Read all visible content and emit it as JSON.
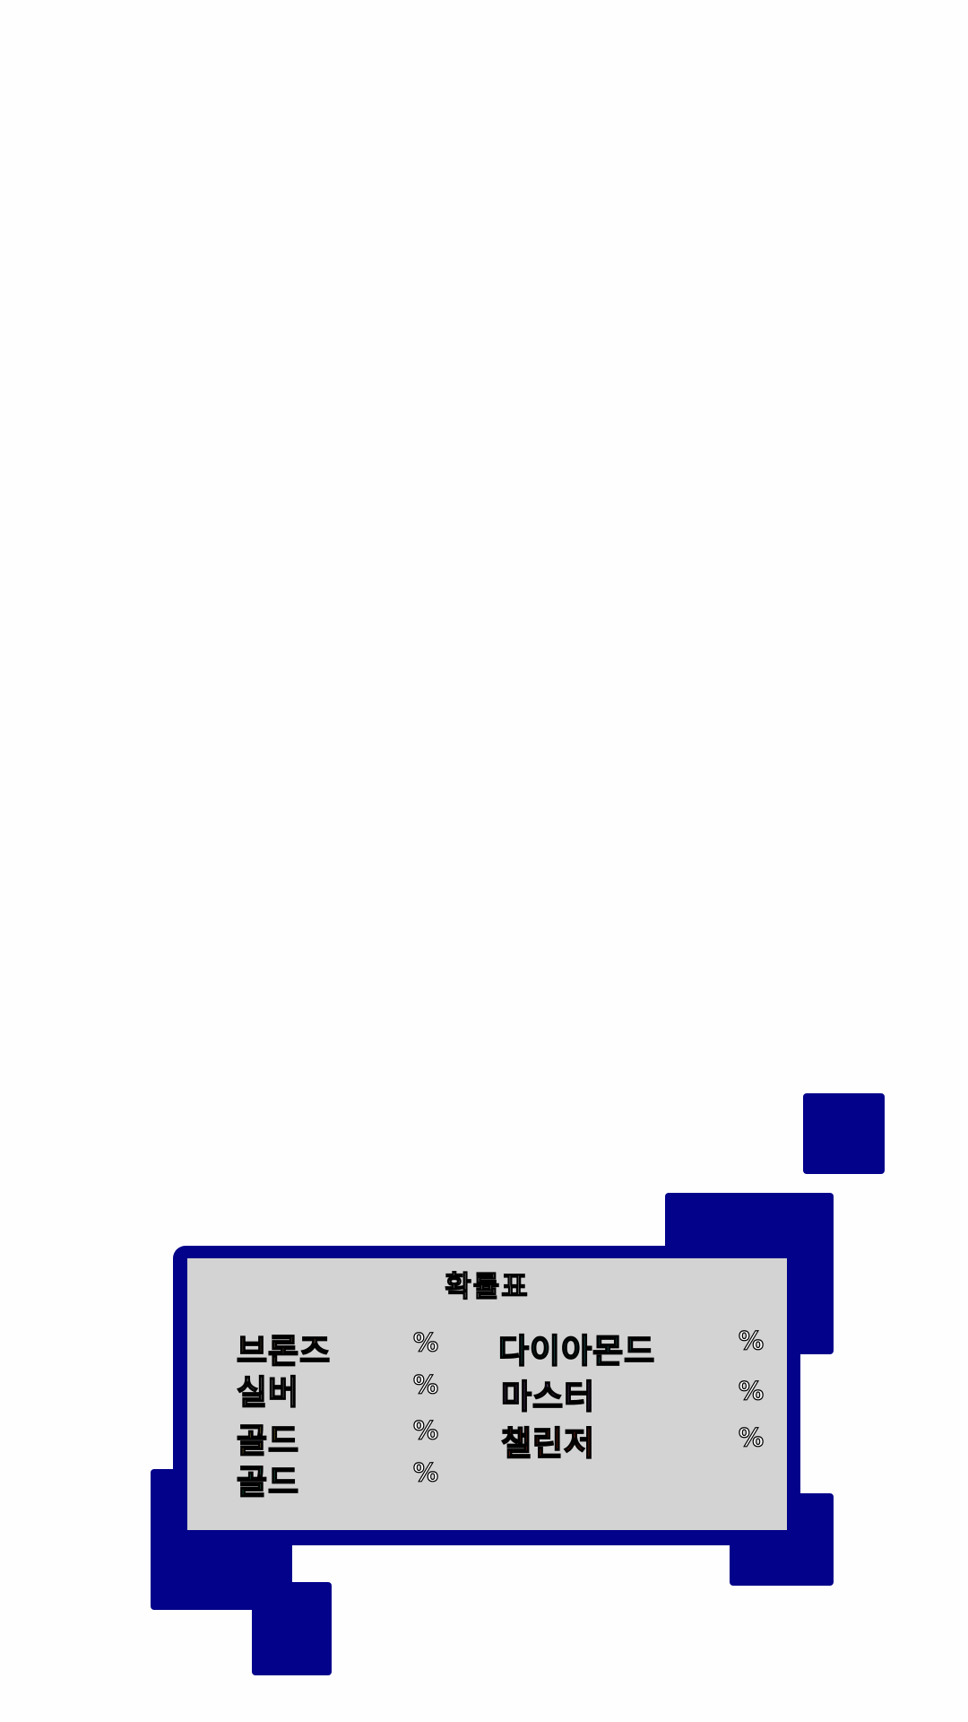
{
  "probability_table": {
    "title": "확률표",
    "rows_left": [
      {
        "tier": "브론즈",
        "percent": "%",
        "color": "#a8865e"
      },
      {
        "tier": "실버",
        "percent": "%",
        "color": "#e6e6e6"
      },
      {
        "tier": "골드",
        "percent": "%",
        "color": "#e8c15a"
      },
      {
        "tier": "골드",
        "percent": "%",
        "color": "#2fbf78"
      }
    ],
    "rows_right": [
      {
        "tier": "다이아몬드",
        "percent": "%",
        "color": "#3aa6ad"
      },
      {
        "tier": "마스터",
        "percent": "%",
        "color": "#b070d8"
      },
      {
        "tier": "챌린저",
        "percent": "%",
        "color": "#ee4a1c"
      }
    ]
  },
  "colors": {
    "frame": "#02028a",
    "panel": "#d3d3d3",
    "background": "#fefefe"
  }
}
